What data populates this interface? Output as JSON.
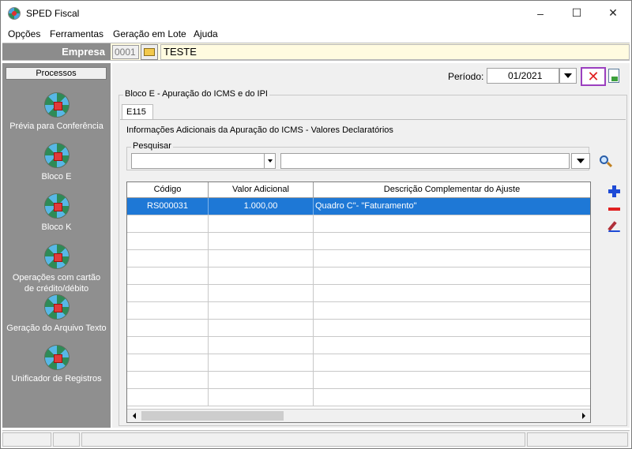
{
  "window": {
    "title": "SPED Fiscal",
    "minimize": "–",
    "maximize": "☐",
    "close": "✕"
  },
  "menu": [
    "Opções",
    "Ferramentas",
    "Geração em Lote",
    "Ajuda"
  ],
  "empresa": {
    "label": "Empresa",
    "code": "0001",
    "name": "TESTE"
  },
  "sidebar": {
    "header": "Processos",
    "items": [
      {
        "label": "Prévia para Conferência",
        "icon": "globe-icon"
      },
      {
        "label": "Bloco E",
        "icon": "globe-icon"
      },
      {
        "label": "Bloco K",
        "icon": "globe-icon"
      },
      {
        "label": "Operações com cartão de crédito/débito",
        "icon": "globe-icon"
      },
      {
        "label": "Geração do Arquivo Texto",
        "icon": "globe-icon"
      },
      {
        "label": "Unificador de Registros",
        "icon": "globe-icon"
      }
    ]
  },
  "periodo": {
    "label": "Período:",
    "value": "01/2021"
  },
  "toolbar": {
    "close_label": "✕"
  },
  "bloco": {
    "title": "Bloco E - Apuração do ICMS e do IPI",
    "tab": "E115",
    "info": "Informações Adicionais da Apuração do ICMS - Valores Declaratórios"
  },
  "search": {
    "title": "Pesquisar",
    "field_value": "",
    "text_value": ""
  },
  "table": {
    "columns": [
      "Código",
      "Valor Adicional",
      "Descrição Complementar do Ajuste"
    ],
    "rows": [
      {
        "codigo": "RS000031",
        "valor": "1.000,00",
        "descricao": "Quadro C\"- \"Faturamento\""
      }
    ],
    "empty_rows": 11
  },
  "colors": {
    "selection": "#1e78d6",
    "sidebar": "#8f8f8f",
    "empresa_bg": "#fffbe0",
    "highlight_border": "#9b3fbf"
  }
}
